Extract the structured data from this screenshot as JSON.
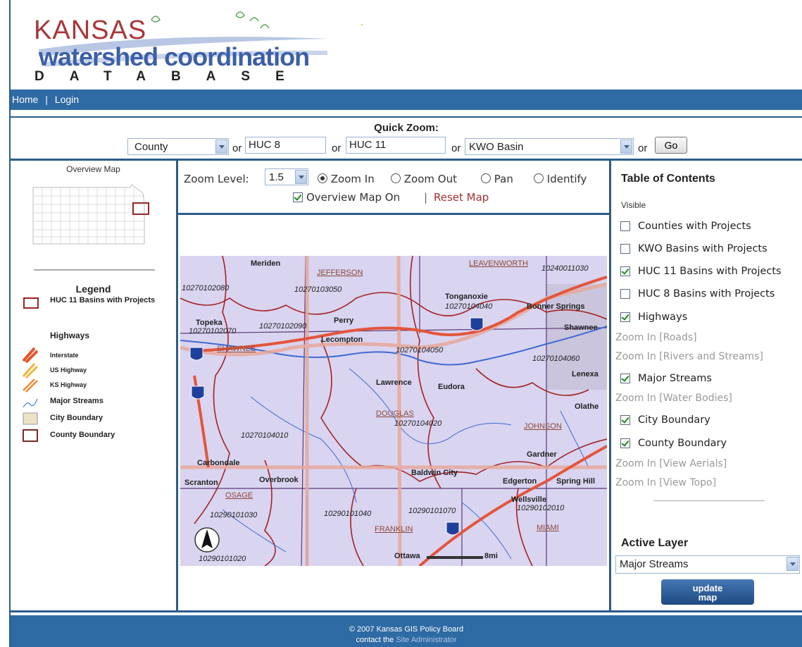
{
  "header": {
    "logo_top": "KANSAS",
    "logo_middle": "watershed coordination",
    "logo_bottom": "DATABASE"
  },
  "nav": {
    "home": "Home",
    "sep": "|",
    "login": "Login"
  },
  "quick_zoom": {
    "title": "Quick Zoom:",
    "county": "County",
    "or": "or",
    "huc8": "HUC 8",
    "huc11": "HUC 11",
    "kwo": "KWO Basin",
    "go": "Go"
  },
  "left": {
    "overview_title": "Overview Map",
    "legend_title": "Legend",
    "huc11_label": "HUC 11 Basins with Projects",
    "highways_title": "Highways",
    "interstate": "Interstate",
    "us_highway": "US Highway",
    "ks_highway": "KS Highway",
    "major_streams": "Major Streams",
    "city_boundary": "City Boundary",
    "county_boundary": "County Boundary"
  },
  "controls": {
    "zoom_level_label": "Zoom Level:",
    "zoom_level_value": "1.5",
    "zoom_in": "Zoom In",
    "zoom_out": "Zoom Out",
    "pan": "Pan",
    "identify": "Identify",
    "overview_on": "Overview Map On",
    "sep": "|",
    "reset": "Reset Map"
  },
  "map": {
    "labels": {
      "meriden": "Meriden",
      "jefferson": "JEFFERSON",
      "leavenworth": "LEAVENWORTH",
      "h1": "10240011030",
      "h2": "10270102080",
      "h3": "10270103050",
      "tonganoxie": "Tonganoxie",
      "h4": "10270104040",
      "bonner": "Bonner Springs",
      "topeka": "Topeka",
      "h5": "10270102070",
      "h6": "10270102090",
      "perry": "Perry",
      "shawnee_city": "Shawnee",
      "lecompton": "Lecompton",
      "shawnee_cty": "SHAWNEE",
      "h7": "10270104050",
      "h8": "10270104060",
      "lenexa": "Lenexa",
      "lawrence": "Lawrence",
      "eudora": "Eudora",
      "olathe": "Olathe",
      "douglas": "DOUGLAS",
      "h9": "10270104020",
      "johnson": "JOHNSON",
      "h10": "10270104010",
      "gardner": "Gardner",
      "carbondale": "Carbondale",
      "overbrook": "Overbrook",
      "baldwin": "Baldwin City",
      "edgerton": "Edgerton",
      "spring_hill": "Spring Hill",
      "scranton": "Scranton",
      "osage": "OSAGE",
      "wellsville": "Wellsville",
      "h11": "10290102010",
      "h12": "10290101030",
      "h13": "10290101040",
      "h14": "10290101070",
      "franklin": "FRANKLIN",
      "miami": "MIAMI",
      "h15": "10290101020",
      "ottawa": "Ottawa",
      "scale": "8mi"
    }
  },
  "toc": {
    "title": "Table of Contents",
    "visible": "Visible",
    "counties": "Counties with Projects",
    "kwo": "KWO Basins with Projects",
    "huc11": "HUC 11 Basins with Projects",
    "huc8": "HUC 8 Basins with Projects",
    "highways": "Highways",
    "zoom_roads": "Zoom In [Roads]",
    "zoom_rivers": "Zoom In [Rivers and Streams]",
    "major_streams": "Major Streams",
    "zoom_water": "Zoom In [Water Bodies]",
    "city_boundary": "City Boundary",
    "county_boundary": "County Boundary",
    "zoom_aerials": "Zoom In [View Aerials]",
    "zoom_topo": "Zoom In [View Topo]",
    "active_layer": "Active Layer",
    "active_value": "Major Streams",
    "update": "update map"
  },
  "footer": {
    "copyright": "© 2007 Kansas GIS Policy Board",
    "contact_prefix": "contact the",
    "contact_link": "Site Administrator"
  }
}
